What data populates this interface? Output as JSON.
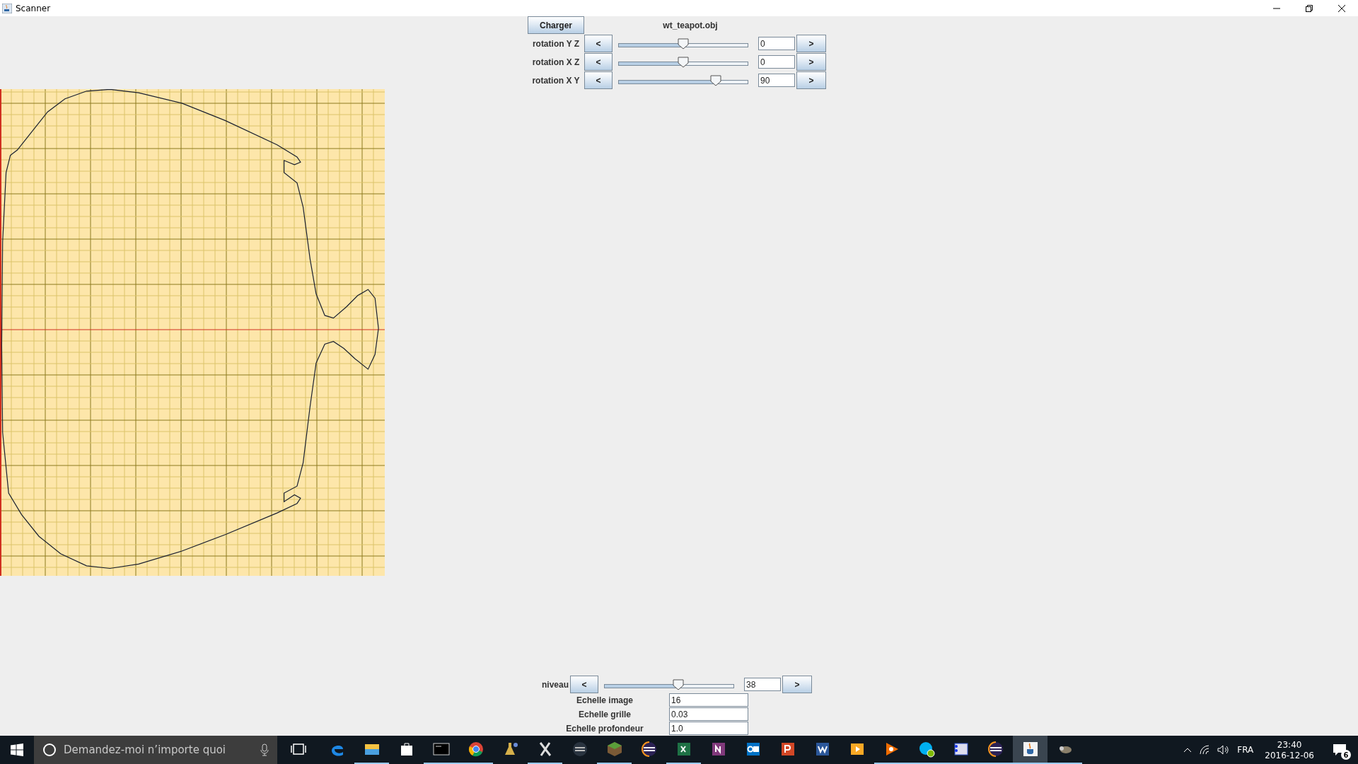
{
  "window": {
    "title": "Scanner"
  },
  "loader": {
    "button": "Charger",
    "file_name": "wt_teapot.obj"
  },
  "rotations": [
    {
      "label": "rotation Y Z",
      "decrement": "<",
      "level": 0.5,
      "value": "0",
      "increment": ">"
    },
    {
      "label": "rotation X Z",
      "decrement": "<",
      "level": 0.5,
      "value": "0",
      "increment": ">"
    },
    {
      "label": "rotation X Y",
      "decrement": "<",
      "level": 0.75,
      "value": "90",
      "increment": ">"
    }
  ],
  "depth": {
    "label": "niveau",
    "decrement": "<",
    "level": 0.57,
    "value": "38",
    "increment": ">"
  },
  "scales": [
    {
      "label": "Echelle image",
      "value": "16"
    },
    {
      "label": "Echelle grille",
      "value": "0.03"
    },
    {
      "label": "Echelle profondeur",
      "value": "1.0"
    }
  ],
  "taskbar": {
    "placeholder": "Demandez-moi n’importe quoi",
    "apps": [
      {
        "running": false,
        "selected": false
      },
      {
        "running": true,
        "selected": false
      },
      {
        "running": false,
        "selected": false
      },
      {
        "running": true,
        "selected": false
      },
      {
        "running": true,
        "selected": false
      },
      {
        "running": false,
        "selected": false
      },
      {
        "running": true,
        "selected": false
      },
      {
        "running": false,
        "selected": false
      },
      {
        "running": true,
        "selected": false
      },
      {
        "running": false,
        "selected": false
      },
      {
        "running": true,
        "selected": false
      },
      {
        "running": false,
        "selected": false
      },
      {
        "running": false,
        "selected": false
      },
      {
        "running": false,
        "selected": false
      },
      {
        "running": false,
        "selected": false
      },
      {
        "running": false,
        "selected": false
      },
      {
        "running": true,
        "selected": false
      },
      {
        "running": true,
        "selected": false
      },
      {
        "running": true,
        "selected": false
      },
      {
        "running": true,
        "selected": false
      },
      {
        "running": true,
        "selected": true
      },
      {
        "running": true,
        "selected": false
      }
    ],
    "language": "FRA",
    "time": "23:40",
    "date": "2016-12-06",
    "notification_count": "6"
  }
}
